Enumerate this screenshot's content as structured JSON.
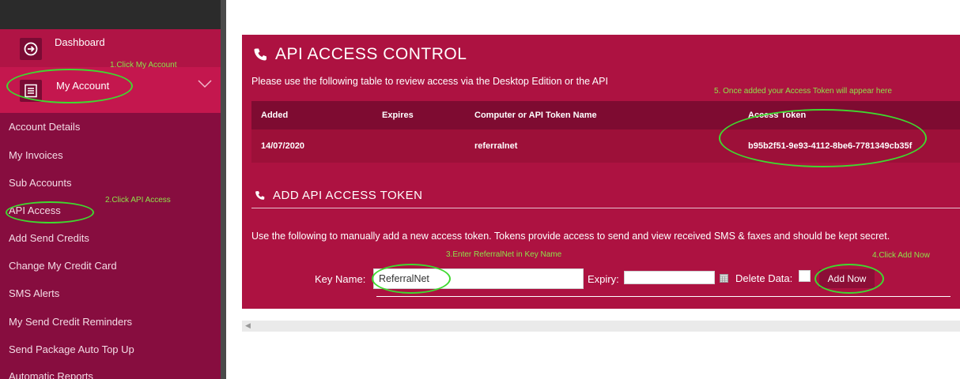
{
  "sidebar": {
    "dashboard_label": "Dashboard",
    "account_label": "My Account",
    "items": [
      {
        "label": "Account Details"
      },
      {
        "label": "My Invoices"
      },
      {
        "label": "Sub Accounts"
      },
      {
        "label": "API Access"
      },
      {
        "label": "Add Send Credits"
      },
      {
        "label": "Change My Credit Card"
      },
      {
        "label": "SMS Alerts"
      },
      {
        "label": "My Send Credit Reminders"
      },
      {
        "label": "Send Package Auto Top Up"
      },
      {
        "label": "Automatic Reports"
      }
    ]
  },
  "annotations": {
    "step1": "1.Click My Account",
    "step2": "2.Click API Access",
    "step3": "3.Enter ReferralNet in Key Name",
    "step4": "4.Click Add Now",
    "step5": "5. Once added your Access Token will appear here"
  },
  "panel": {
    "title": "API ACCESS CONTROL",
    "description": "Please use the following table to review access via the Desktop Edition or the API",
    "table": {
      "headers": [
        "Added",
        "Expires",
        "Computer or API Token Name",
        "Access Token"
      ],
      "rows": [
        {
          "added": "14/07/2020",
          "expires": "",
          "name": "referralnet",
          "token": "b95b2f51-9e93-4112-8be6-7781349cb35f"
        }
      ]
    },
    "add_section": {
      "title": "ADD API ACCESS TOKEN",
      "description": "Use the following to manually add a new access token. Tokens provide access to send and view received SMS & faxes and should be kept secret.",
      "key_name_label": "Key Name:",
      "key_name_value": "ReferralNet",
      "expiry_label": "Expiry:",
      "expiry_value": "",
      "delete_data_label": "Delete Data:",
      "add_button_label": "Add Now"
    }
  },
  "colors": {
    "brand_dark": "#870d3f",
    "brand": "#ad1241",
    "annotation": "#3fd92f"
  }
}
